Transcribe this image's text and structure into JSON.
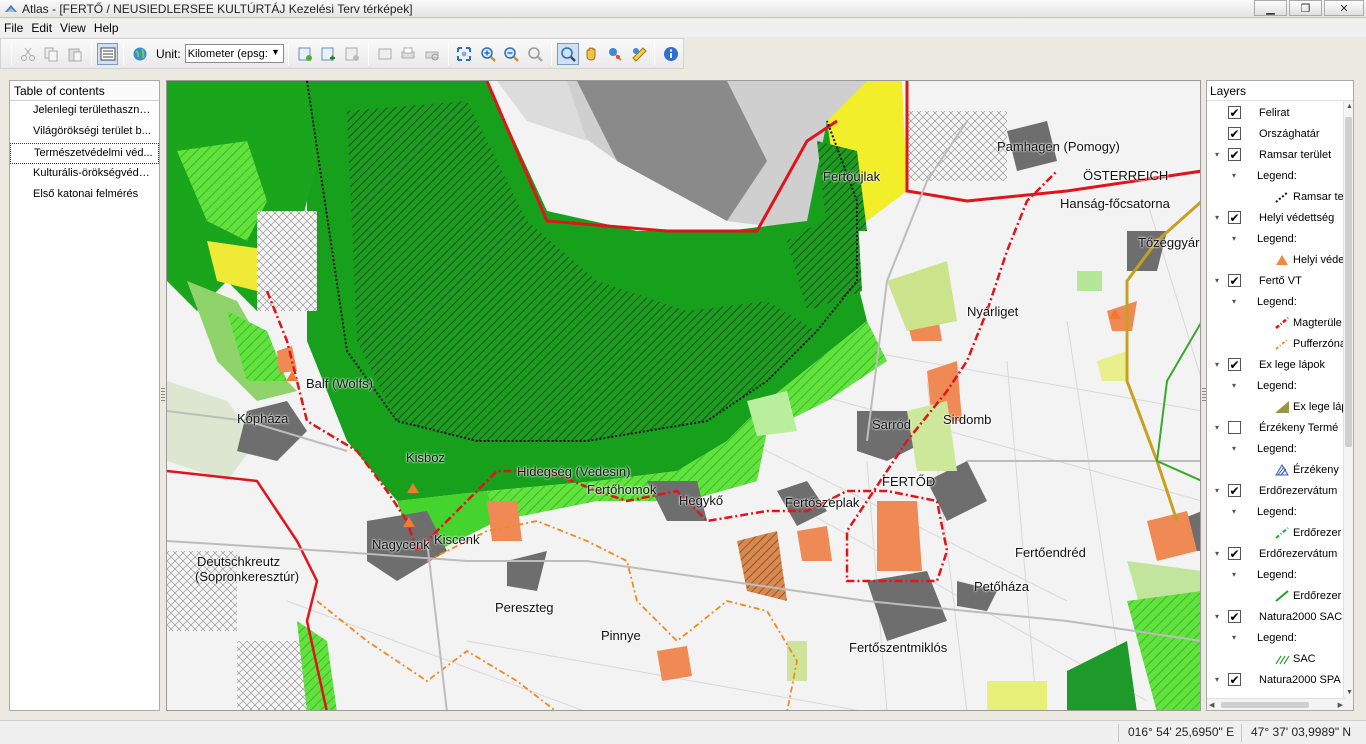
{
  "window": {
    "title": "Atlas - [FERTŐ / NEUSIEDLERSEE KULTÚRTÁJ Kezelési Terv térképek]",
    "controls": [
      "▁",
      "❐",
      "✕"
    ]
  },
  "menu": [
    "File",
    "Edit",
    "View",
    "Help"
  ],
  "toolbar": {
    "unit_label": "Unit:",
    "unit_value": "Kilometer (epsg:"
  },
  "toc": {
    "header": "Table of contents",
    "items": [
      "Jelenlegi területhasználat",
      "Világörökségi terület  b...",
      "Természetvédelmi véd...",
      "Kulturális-örökségvédelem",
      "Első katonai felmérés"
    ]
  },
  "map": {
    "labels": [
      "Pamhagen (Pomogy)",
      "ÖSTERREICH",
      "Hanság-főcsatorna",
      "Fertőújlak",
      "Tőzeggyár",
      "Nyárliget",
      "Balf (Wolfs)",
      "Kópháza",
      "Sarród",
      "Sirdomb",
      "Kisboz",
      "Hidegség (Vedesin)",
      "FERTŐD",
      "Fertőhomok",
      "Hegykő",
      "Fertőszéplak",
      "Nagycenk",
      "Kiscenk",
      "Fertőendréd",
      "Deutschkreutz",
      "(Sopronkeresztúr)",
      "Pereszteg",
      "Petőháza",
      "Pinnye",
      "Fertőszentmiklós"
    ]
  },
  "layers": {
    "header": "Layers",
    "rows": [
      {
        "type": "layer",
        "label": "Felirat",
        "checked": true,
        "expander": ""
      },
      {
        "type": "layer",
        "label": "Országhatár",
        "checked": true,
        "expander": ""
      },
      {
        "type": "layer",
        "label": "Ramsar terület",
        "checked": true,
        "expander": "▾"
      },
      {
        "type": "legend",
        "label": "Legend:"
      },
      {
        "type": "symbol",
        "label": "Ramsar te",
        "symbol": "dotted-black"
      },
      {
        "type": "layer",
        "label": "Helyi védettség",
        "checked": true,
        "expander": "▾"
      },
      {
        "type": "legend",
        "label": "Legend:"
      },
      {
        "type": "symbol",
        "label": "Helyi véde",
        "symbol": "orange-triangle"
      },
      {
        "type": "layer",
        "label": "Fertő VT",
        "checked": true,
        "expander": "▾"
      },
      {
        "type": "legend",
        "label": "Legend:"
      },
      {
        "type": "symbol",
        "label": "Magterüle",
        "symbol": "red-dashdot"
      },
      {
        "type": "symbol",
        "label": "Pufferzóna",
        "symbol": "orange-dashdot"
      },
      {
        "type": "layer",
        "label": "Ex lege lápok",
        "checked": true,
        "expander": "▾"
      },
      {
        "type": "legend",
        "label": "Legend:"
      },
      {
        "type": "symbol",
        "label": "Ex lege láp",
        "symbol": "olive-fill"
      },
      {
        "type": "layer",
        "label": "Érzékeny Termé",
        "checked": false,
        "expander": "▾"
      },
      {
        "type": "legend",
        "label": "Legend:"
      },
      {
        "type": "symbol",
        "label": "Érzékeny",
        "symbol": "blue-hatch"
      },
      {
        "type": "layer",
        "label": "Erdőrezervátum",
        "checked": true,
        "expander": "▾"
      },
      {
        "type": "legend",
        "label": "Legend:"
      },
      {
        "type": "symbol",
        "label": "Erdőrezer",
        "symbol": "green-dashdot"
      },
      {
        "type": "layer",
        "label": "Erdőrezervátum",
        "checked": true,
        "expander": "▾"
      },
      {
        "type": "legend",
        "label": "Legend:"
      },
      {
        "type": "symbol",
        "label": "Erdőrezer",
        "symbol": "green-line"
      },
      {
        "type": "layer",
        "label": "Natura2000 SAC",
        "checked": true,
        "expander": "▾"
      },
      {
        "type": "legend",
        "label": "Legend:"
      },
      {
        "type": "symbol",
        "label": "SAC",
        "symbol": "green-hatch"
      },
      {
        "type": "layer",
        "label": "Natura2000 SPA",
        "checked": true,
        "expander": "▾"
      }
    ]
  },
  "status": {
    "longitude": "016° 54' 25,6950\" E",
    "latitude": "47° 37' 03,9989\" N"
  },
  "colors": {
    "forest_dark": "#0c8a1f",
    "forest": "#1aa81e",
    "green_light": "#58e23a",
    "yellow": "#f2ee2a",
    "orange": "#f08a55",
    "border_red": "#e0141a"
  }
}
